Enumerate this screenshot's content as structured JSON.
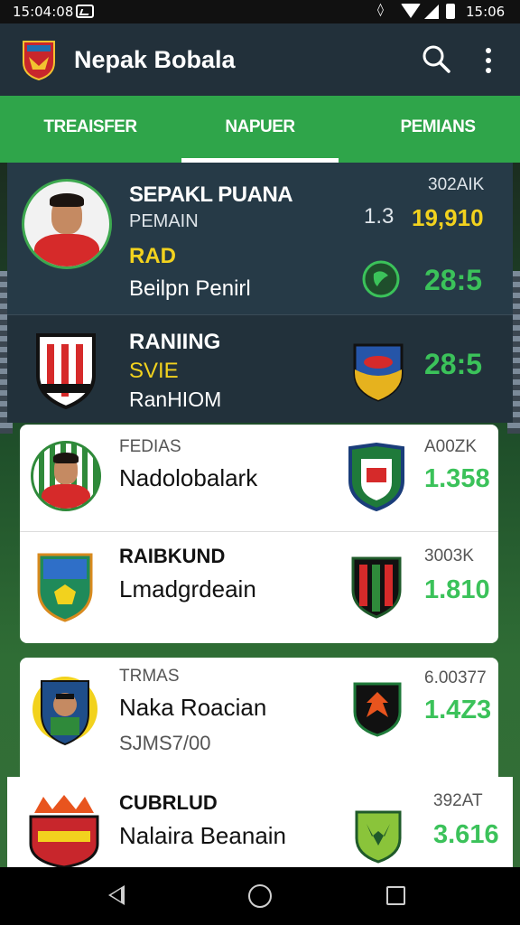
{
  "status_bar": {
    "time_left": "15:04:08",
    "time_right": "15:06"
  },
  "app": {
    "title": "Nepak Bobala"
  },
  "tabs": [
    {
      "label": "TREAISFER"
    },
    {
      "label": "NAPUER"
    },
    {
      "label": "PEMIANS"
    }
  ],
  "featured": {
    "name": "SEPAKL PUANA",
    "role": "PEMAIN",
    "tag": "RAD",
    "subtitle": "Beilpn Penirl",
    "code": "302AIK",
    "value_a": "1.3",
    "value_b": "19,910",
    "score": "28:5"
  },
  "ranking": {
    "title": "RANIING",
    "tag": "SVIE",
    "subtitle": "RanHIOM",
    "score": "28:5"
  },
  "list": [
    {
      "label": "FEDIAS",
      "name": "Nadolobalark",
      "code": "A00ZK",
      "value": "1.358"
    },
    {
      "label": "RAIBKUND",
      "name": "Lmadgrdeain",
      "code": "3003K",
      "value": "1.810"
    },
    {
      "label": "TRMAS",
      "name": "Naka Roacian",
      "sub": "SJMS7/00",
      "code": "6.00377",
      "value": "1.4Z3"
    },
    {
      "label": "CUBRLUD",
      "name": "Nalaira Beanain",
      "code": "392AT",
      "value": "3.616"
    }
  ],
  "colors": {
    "tab_green": "#2fa54a",
    "app_bar": "#22303a",
    "accent_yellow": "#f2d21e",
    "value_green": "#3bc25a"
  }
}
